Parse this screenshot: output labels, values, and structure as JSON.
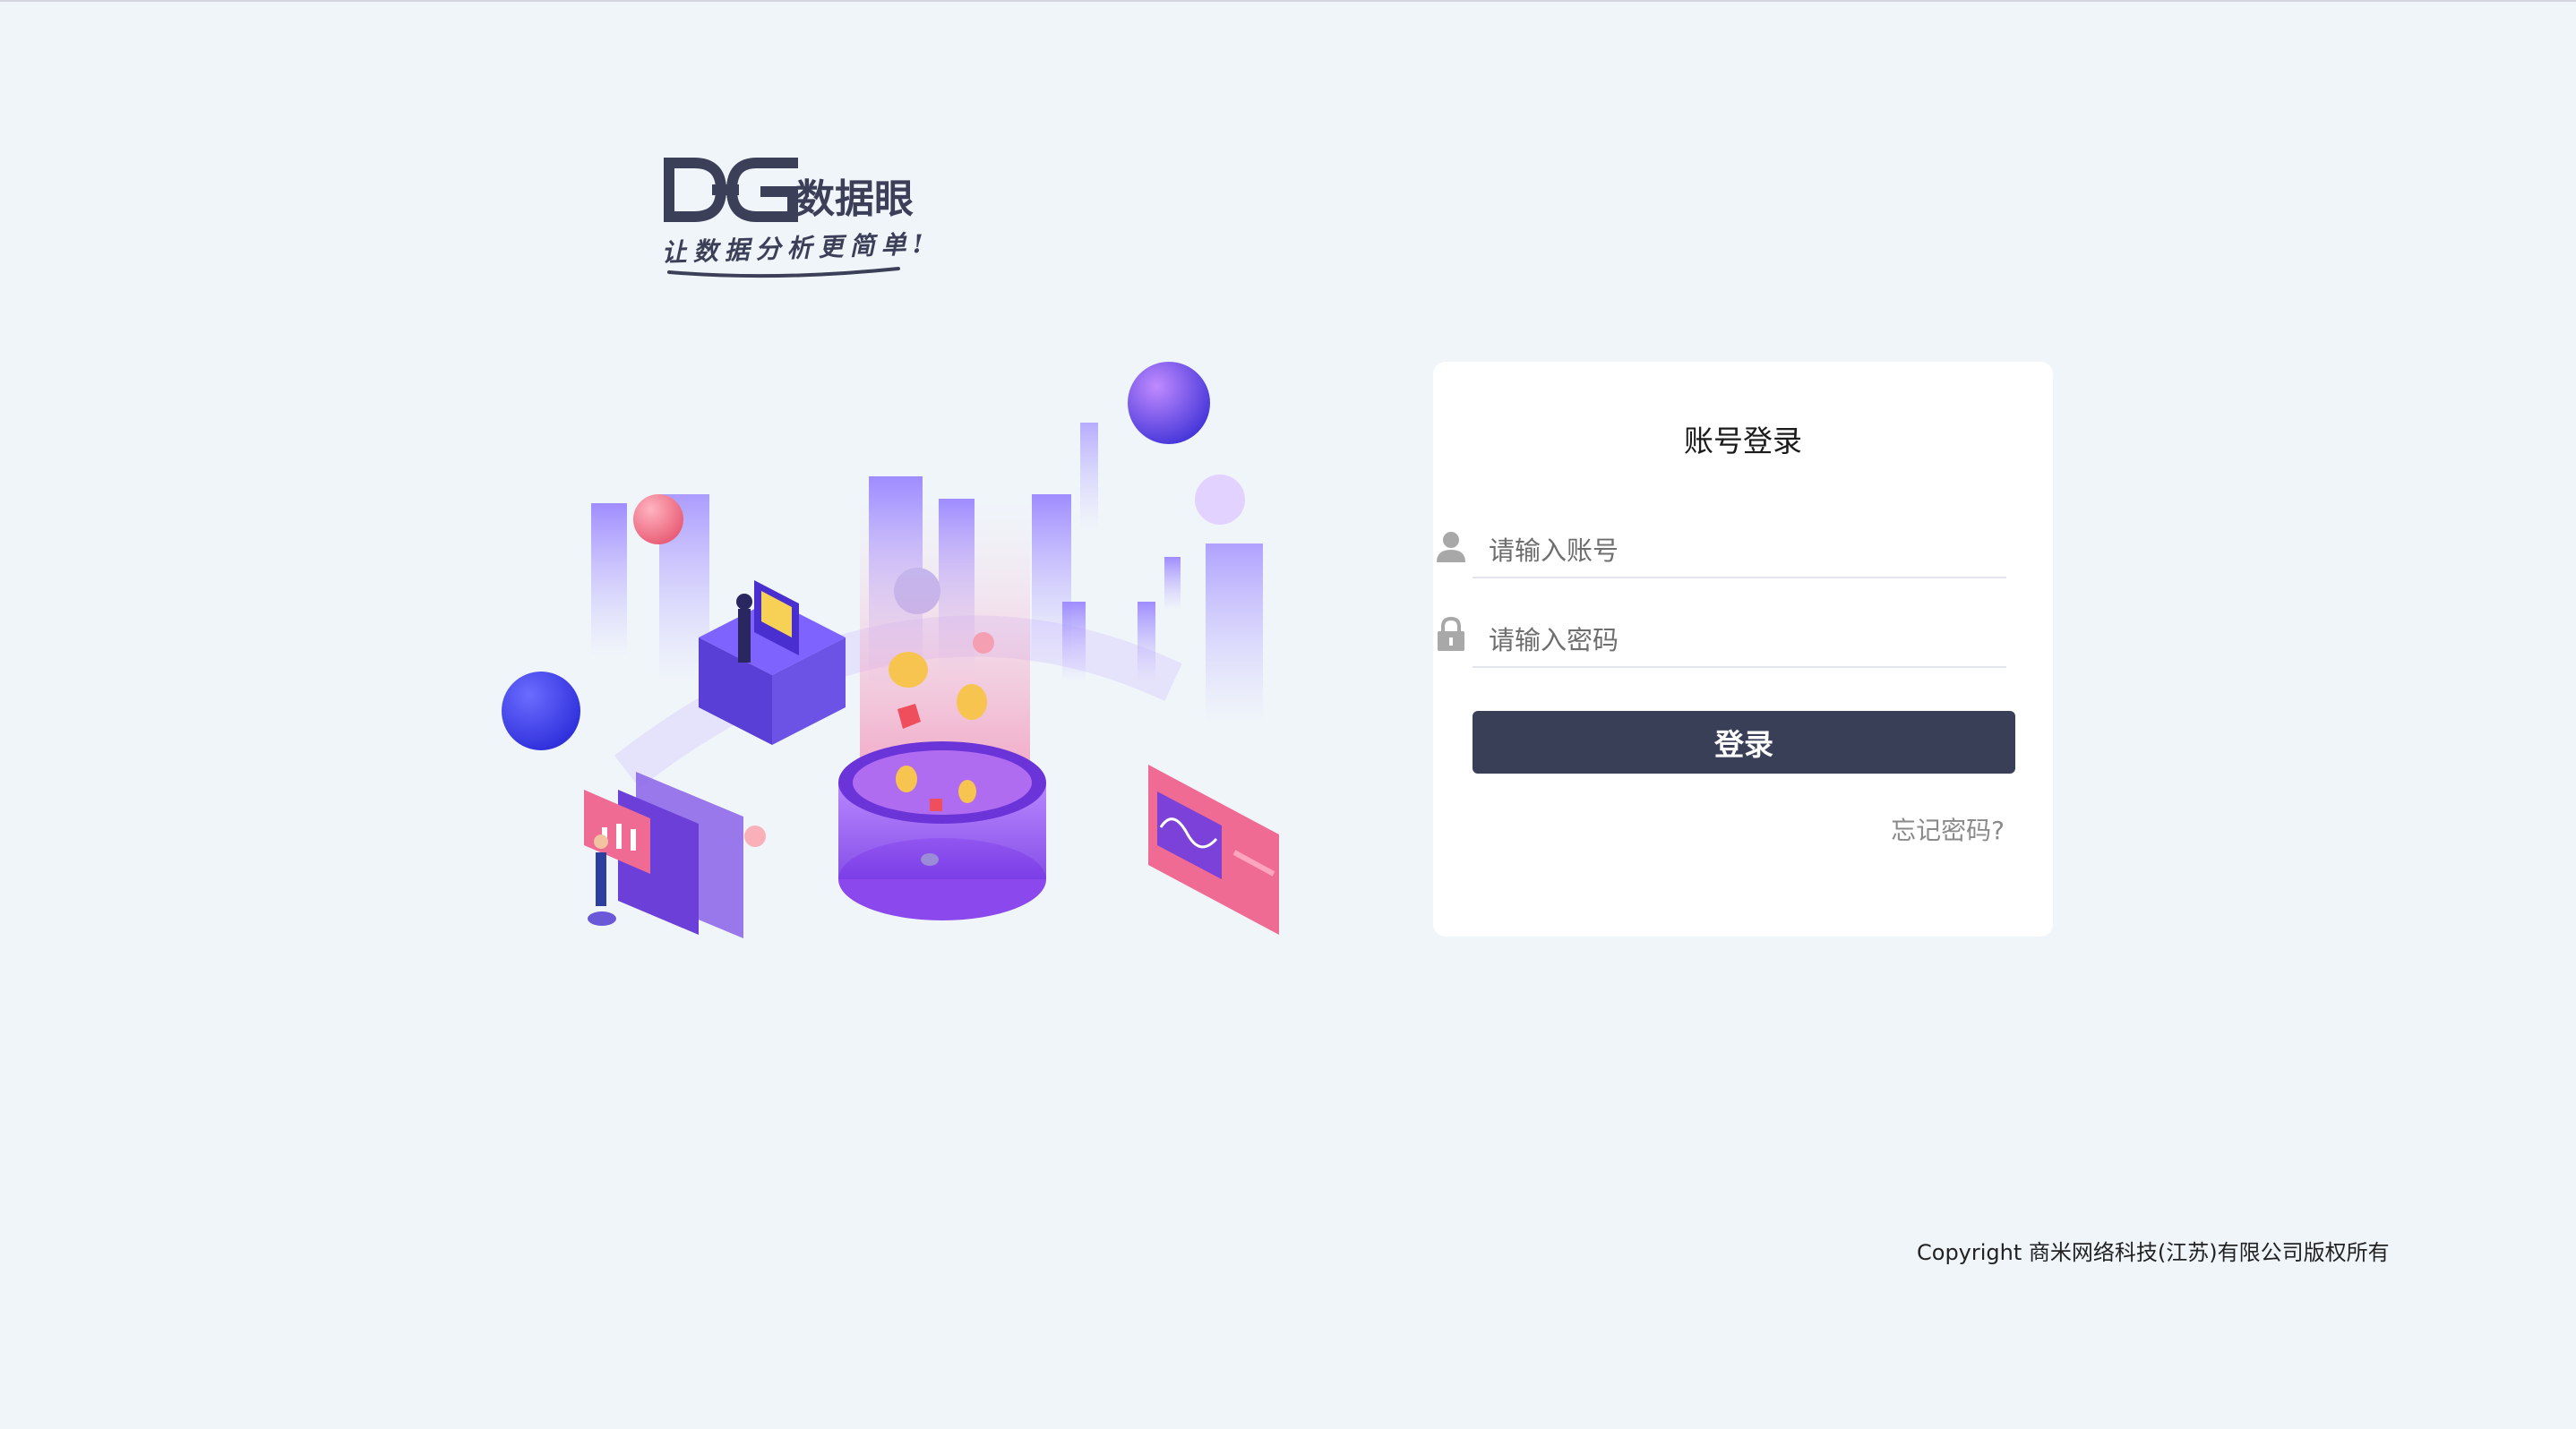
{
  "brand": {
    "mark": "DG",
    "name": "数据眼",
    "slogan": "让数据分析更简单!"
  },
  "login": {
    "title": "账号登录",
    "account_placeholder": "请输入账号",
    "password_placeholder": "请输入密码",
    "submit_label": "登录",
    "forgot_label": "忘记密码?"
  },
  "footer": {
    "copyright": "Copyright 商米网络科技(江苏)有限公司版权所有"
  },
  "colors": {
    "background": "#f0f5fa",
    "button": "#3a3f58",
    "brand_text": "#3b4058",
    "accent_purple": "#6a3fe0",
    "accent_pink": "#f06b93"
  },
  "icons": [
    "user-icon",
    "lock-icon"
  ]
}
